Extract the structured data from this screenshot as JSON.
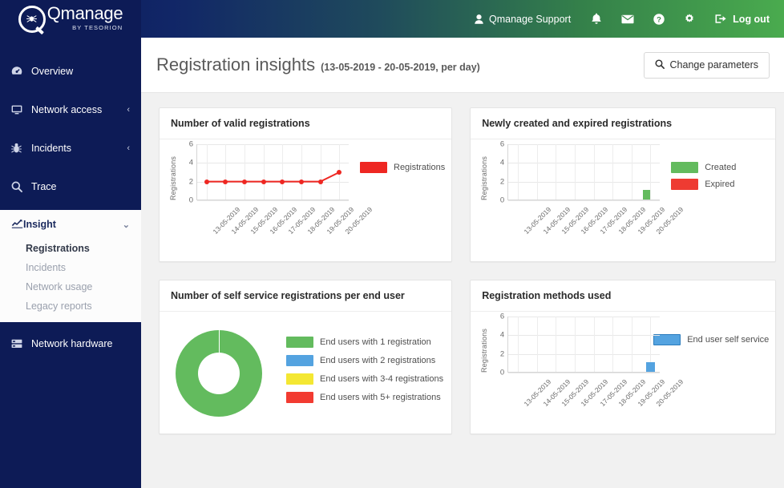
{
  "brand": {
    "name": "Qmanage",
    "tagline": "BY TESORION",
    "logo_icon": "spider-icon"
  },
  "topbar": {
    "user": {
      "label": "Qmanage Support",
      "icon": "user-icon"
    },
    "icons": [
      {
        "name": "notifications-icon",
        "glyph": "bell"
      },
      {
        "name": "messages-icon",
        "glyph": "envelope"
      },
      {
        "name": "help-icon",
        "glyph": "question-circle"
      },
      {
        "name": "settings-icon",
        "glyph": "gear"
      }
    ],
    "logout": {
      "label": "Log out",
      "icon": "sign-out-icon"
    }
  },
  "sidebar": {
    "items": [
      {
        "label": "Overview",
        "icon": "dashboard-icon",
        "chevron": ""
      },
      {
        "label": "Network access",
        "icon": "monitor-icon",
        "chevron": "‹"
      },
      {
        "label": "Incidents",
        "icon": "bug-icon",
        "chevron": "‹"
      },
      {
        "label": "Trace",
        "icon": "search-icon",
        "chevron": ""
      }
    ],
    "insight": {
      "label": "Insight",
      "icon": "line-chart-icon",
      "chevron": "⌄",
      "subitems": [
        {
          "label": "Registrations",
          "active": true
        },
        {
          "label": "Incidents",
          "active": false
        },
        {
          "label": "Network usage",
          "active": false
        },
        {
          "label": "Legacy reports",
          "active": false
        }
      ]
    },
    "hardware": {
      "label": "Network hardware",
      "icon": "server-icon"
    }
  },
  "page": {
    "title": "Registration insights",
    "subtitle": "(13-05-2019 - 20-05-2019, per day)",
    "change_parameters_button": "Change parameters",
    "change_parameters_icon": "search-icon"
  },
  "colors": {
    "red": "#ee2722",
    "green": "#63bb5e",
    "blue": "#54a3e0",
    "yellow": "#f4e733",
    "navy": "#0d1b56",
    "header_green": "#4aab4e"
  },
  "chart_data": [
    {
      "type": "line",
      "title": "Number of valid registrations",
      "xlabel": "",
      "ylabel": "Registrations",
      "ylim": [
        0,
        6
      ],
      "yticks": [
        0,
        2,
        4,
        6
      ],
      "grid": true,
      "legend_position": "right",
      "categories": [
        "13-05-2019",
        "14-05-2019",
        "15-05-2019",
        "16-05-2019",
        "17-05-2019",
        "18-05-2019",
        "19-05-2019",
        "20-05-2019"
      ],
      "series": [
        {
          "name": "Registrations",
          "color": "#ee2722",
          "values": [
            2,
            2,
            2,
            2,
            2,
            2,
            2,
            3
          ]
        }
      ]
    },
    {
      "type": "bar",
      "title": "Newly created and expired registrations",
      "xlabel": "",
      "ylabel": "Registrations",
      "ylim": [
        0,
        6
      ],
      "yticks": [
        0,
        2,
        4,
        6
      ],
      "grid": true,
      "legend_position": "right",
      "categories": [
        "13-05-2019",
        "14-05-2019",
        "15-05-2019",
        "16-05-2019",
        "17-05-2019",
        "18-05-2019",
        "19-05-2019",
        "20-05-2019"
      ],
      "series": [
        {
          "name": "Created",
          "color": "#63bb5e",
          "values": [
            0,
            0,
            0,
            0,
            0,
            0,
            0,
            1
          ]
        },
        {
          "name": "Expired",
          "color": "#ee3b32",
          "values": [
            0,
            0,
            0,
            0,
            0,
            0,
            0,
            0
          ]
        }
      ]
    },
    {
      "type": "pie",
      "title": "Number of self service registrations per end user",
      "donut": true,
      "legend_position": "right",
      "labels": [
        "End users with 1 registration",
        "End users with 2 registrations",
        "End users with 3-4 registrations",
        "End users with 5+ registrations"
      ],
      "colors": [
        "#63bb5e",
        "#54a3e0",
        "#f4e733",
        "#f23b31"
      ],
      "values": [
        100,
        0,
        0,
        0
      ]
    },
    {
      "type": "bar",
      "title": "Registration methods used",
      "xlabel": "",
      "ylabel": "Registrations",
      "ylim": [
        0,
        6
      ],
      "yticks": [
        0,
        2,
        4,
        6
      ],
      "grid": true,
      "legend_position": "right",
      "categories": [
        "13-05-2019",
        "14-05-2019",
        "15-05-2019",
        "16-05-2019",
        "17-05-2019",
        "18-05-2019",
        "19-05-2019",
        "20-05-2019"
      ],
      "series": [
        {
          "name": "End user self service",
          "color": "#54a3e0",
          "values": [
            0,
            0,
            0,
            0,
            0,
            0,
            0,
            1
          ]
        }
      ]
    }
  ]
}
